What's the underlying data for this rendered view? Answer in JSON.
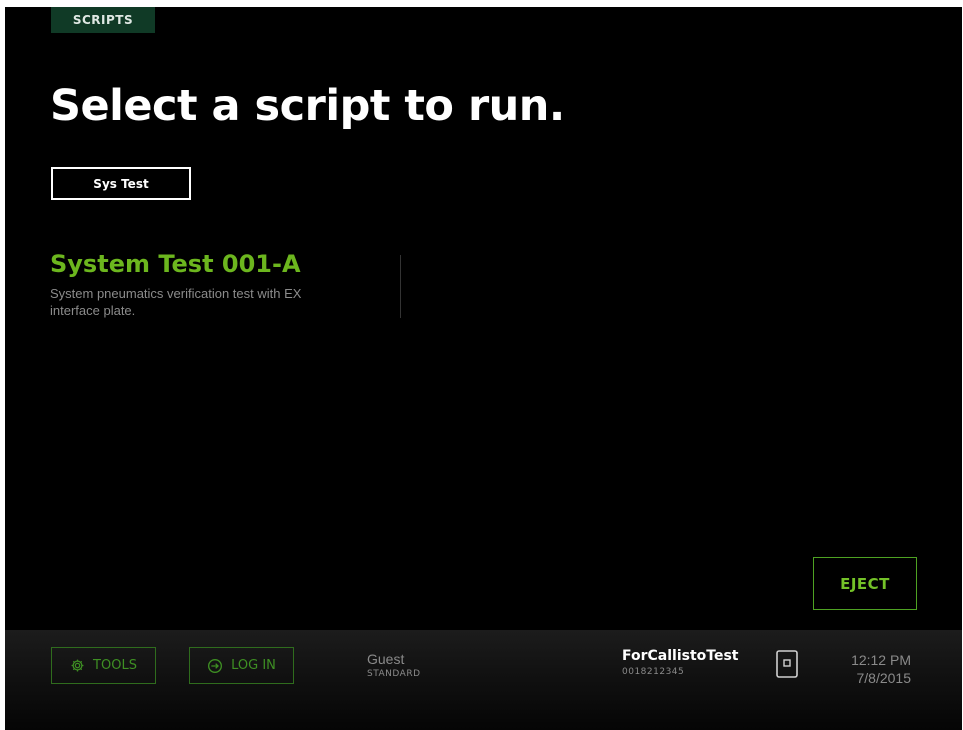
{
  "top_tab": {
    "label": "SCRIPTS"
  },
  "page_title": "Select a script to run.",
  "filter": {
    "label": "Sys Test"
  },
  "scripts": [
    {
      "name": "System Test 001-A",
      "description": "System pneumatics verification test with EX interface plate."
    }
  ],
  "eject_label": "EJECT",
  "footer": {
    "tools_label": "TOOLS",
    "tools_icon": "gear-icon",
    "login_label": "LOG IN",
    "login_icon": "login-arrow-icon",
    "user_name": "Guest",
    "user_role": "STANDARD",
    "device_name": "ForCallistoTest",
    "device_id": "0018212345",
    "device_icon": "device-card-icon",
    "time": "12:12 PM",
    "date": "7/8/2015"
  },
  "colors": {
    "background": "#000000",
    "accent_green": "#6cb61e",
    "tab_bg": "#103a26",
    "footer_button_border": "#2f6c1d",
    "eject_border": "#4ea222"
  }
}
